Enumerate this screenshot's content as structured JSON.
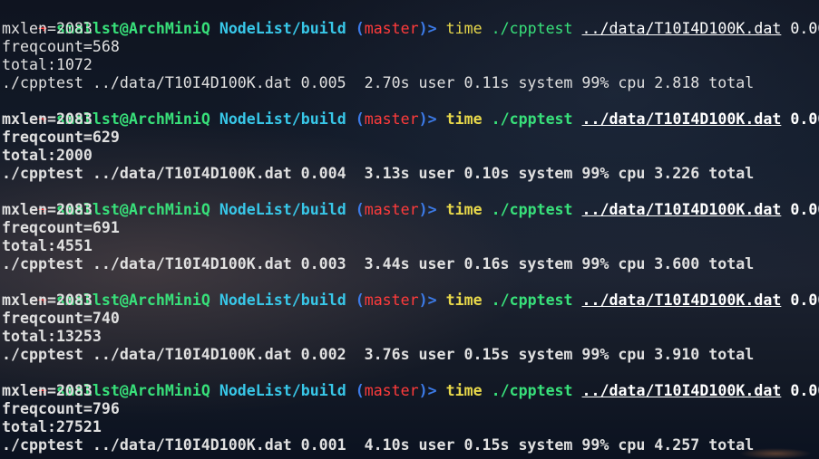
{
  "prompt": {
    "arrow": "➜",
    "user": "smallst",
    "at": "@",
    "host": "ArchMiniQ",
    "path": "NodeList/build",
    "paren_open": "(",
    "branch": "master",
    "paren_close": ")",
    "gt": ">",
    "cmd": "time",
    "prog": "./cpptest",
    "arg": "../data/T10I4D100K.dat"
  },
  "runs": [
    {
      "threshold": "0.005",
      "mxlen": "mxlen=2083",
      "freqcount": "freqcount=568",
      "total": "total:1072",
      "timing": "./cpptest ../data/T10I4D100K.dat 0.005  2.70s user 0.11s system 99% cpu 2.818 total",
      "bold": false
    },
    {
      "threshold": "0.004",
      "mxlen": "mxlen=2083",
      "freqcount": "freqcount=629",
      "total": "total:2000",
      "timing": "./cpptest ../data/T10I4D100K.dat 0.004  3.13s user 0.10s system 99% cpu 3.226 total",
      "bold": true
    },
    {
      "threshold": "0.003",
      "mxlen": "mxlen=2083",
      "freqcount": "freqcount=691",
      "total": "total:4551",
      "timing": "./cpptest ../data/T10I4D100K.dat 0.003  3.44s user 0.16s system 99% cpu 3.600 total",
      "bold": true
    },
    {
      "threshold": "0.002",
      "mxlen": "mxlen=2083",
      "freqcount": "freqcount=740",
      "total": "total:13253",
      "timing": "./cpptest ../data/T10I4D100K.dat 0.002  3.76s user 0.15s system 99% cpu 3.910 total",
      "bold": true
    },
    {
      "threshold": "0.001",
      "mxlen": "mxlen=2083",
      "freqcount": "freqcount=796",
      "total": "total:27521",
      "timing": "./cpptest ../data/T10I4D100K.dat 0.001  4.10s user 0.15s system 99% cpu 4.257 total",
      "bold": true
    }
  ],
  "colors": {
    "arrow": "#ff3b3b",
    "user_host": "#38e07a",
    "path": "#38c7e8",
    "branch": "#ff3b3b",
    "command": "#e8d84a"
  }
}
